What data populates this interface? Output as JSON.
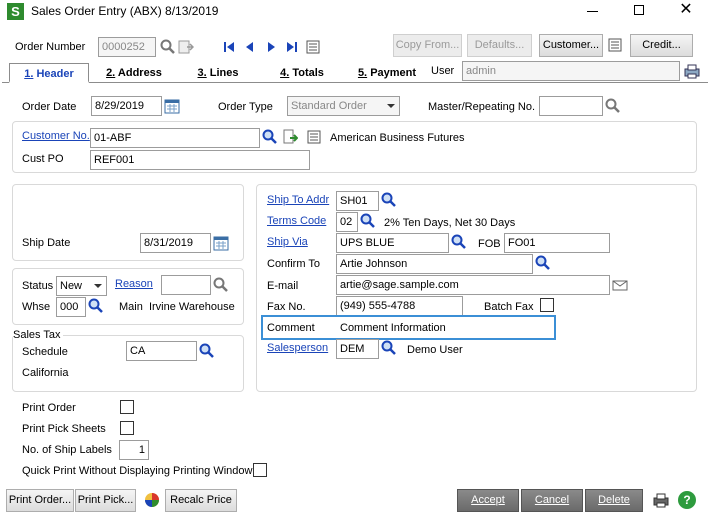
{
  "window": {
    "title": "Sales Order Entry (ABX) 8/13/2019",
    "app_icon_letter": "S"
  },
  "toolbar": {
    "order_number_label": "Order Number",
    "order_number_value": "0000252",
    "copy_from": "Copy From...",
    "defaults": "Defaults...",
    "customer": "Customer...",
    "credit": "Credit..."
  },
  "tabs": [
    {
      "num": "1.",
      "label": "Header"
    },
    {
      "num": "2.",
      "label": "Address"
    },
    {
      "num": "3.",
      "label": "Lines"
    },
    {
      "num": "4.",
      "label": "Totals"
    },
    {
      "num": "5.",
      "label": "Payment"
    }
  ],
  "user": {
    "label": "User",
    "value": "admin"
  },
  "header": {
    "order_date_label": "Order Date",
    "order_date_value": "8/29/2019",
    "order_type_label": "Order Type",
    "order_type_value": "Standard Order",
    "master_repeating_label": "Master/Repeating No.",
    "master_repeating_value": ""
  },
  "customer": {
    "customer_no_label": "Customer No.",
    "customer_no_value": "01-ABF",
    "customer_name": "American Business Futures",
    "cust_po_label": "Cust PO",
    "cust_po_value": "REF001"
  },
  "ship": {
    "ship_date_label": "Ship Date",
    "ship_date_value": "8/31/2019"
  },
  "status": {
    "status_label": "Status",
    "status_value": "New",
    "reason_label": "Reason",
    "reason_value": "",
    "whse_label": "Whse",
    "whse_value": "000",
    "whse_desc": "Main  Irvine Warehouse"
  },
  "sales_tax": {
    "group_label": "Sales Tax",
    "schedule_label": "Schedule",
    "schedule_value": "CA",
    "schedule_desc": "California"
  },
  "shipping": {
    "ship_to_addr_label": "Ship To Addr",
    "ship_to_addr_value": "SH01",
    "terms_code_label": "Terms Code",
    "terms_code_value": "02",
    "terms_desc": "2% Ten Days, Net 30 Days",
    "ship_via_label": "Ship Via",
    "ship_via_value": "UPS BLUE",
    "fob_label": "FOB",
    "fob_value": "FO01",
    "confirm_to_label": "Confirm To",
    "confirm_to_value": "Artie Johnson",
    "email_label": "E-mail",
    "email_value": "artie@sage.sample.com",
    "fax_label": "Fax No.",
    "fax_value": "(949) 555-4788",
    "batch_fax_label": "Batch Fax",
    "comment_label": "Comment",
    "comment_value": "Comment Information",
    "salesperson_label": "Salesperson",
    "salesperson_value": "DEM",
    "salesperson_name": "Demo User"
  },
  "print_options": {
    "print_order_label": "Print Order",
    "print_pick_label": "Print Pick Sheets",
    "ship_labels_label": "No. of Ship Labels",
    "ship_labels_value": "1",
    "quick_print_label": "Quick Print Without Displaying Printing Window"
  },
  "bottom": {
    "print_order": "Print Order...",
    "print_pick": "Print Pick...",
    "recalc_price": "Recalc Price",
    "accept": "Accept",
    "cancel": "Cancel",
    "delete": "Delete"
  },
  "colors": {
    "accent": "#1a44b8",
    "highlight_border": "#3b8fd6",
    "app_icon_bg": "#2e8b2e"
  }
}
